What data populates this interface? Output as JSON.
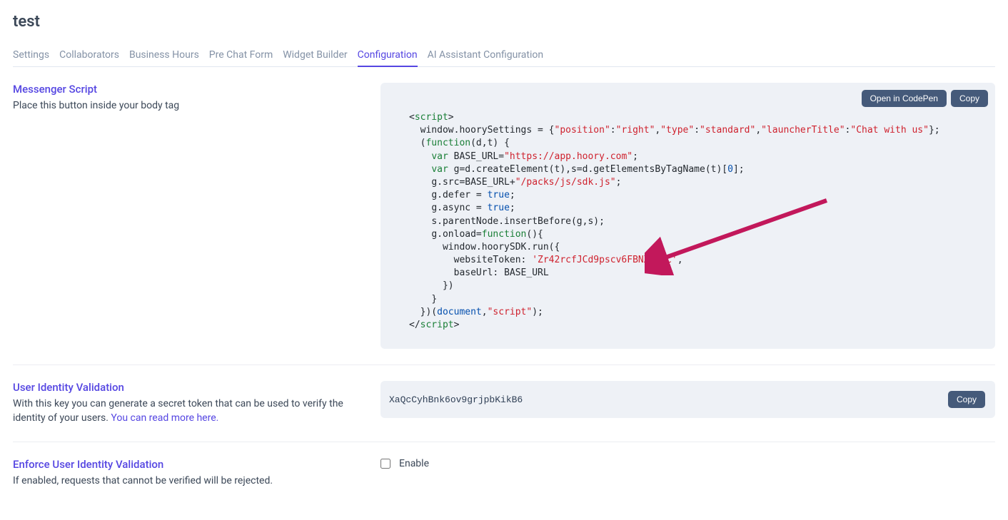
{
  "page_title": "test",
  "tabs": [
    {
      "label": "Settings"
    },
    {
      "label": "Collaborators"
    },
    {
      "label": "Business Hours"
    },
    {
      "label": "Pre Chat Form"
    },
    {
      "label": "Widget Builder"
    },
    {
      "label": "Configuration",
      "active": true
    },
    {
      "label": "AI Assistant Configuration"
    }
  ],
  "messenger": {
    "title": "Messenger Script",
    "desc": "Place this button inside your body tag",
    "actions": {
      "open": "Open in CodePen",
      "copy": "Copy"
    },
    "script": {
      "settings": {
        "position": "right",
        "type": "standard",
        "launcherTitle": "Chat with us"
      },
      "base_url": "https://app.hoory.com",
      "sdk_path": "/packs/js/sdk.js",
      "website_token": "Zr42rcfJCd9pscv6FBNXvvHC"
    }
  },
  "identity": {
    "title": "User Identity Validation",
    "desc_prefix": "With this key you can generate a secret token that can be used to verify the identity of your users. ",
    "desc_link": "You can read more here.",
    "key": "XaQcCyhBnk6ov9grjpbKikB6",
    "copy": "Copy"
  },
  "enforce": {
    "title": "Enforce User Identity Validation",
    "desc": "If enabled, requests that cannot be verified will be rejected.",
    "label": "Enable"
  }
}
